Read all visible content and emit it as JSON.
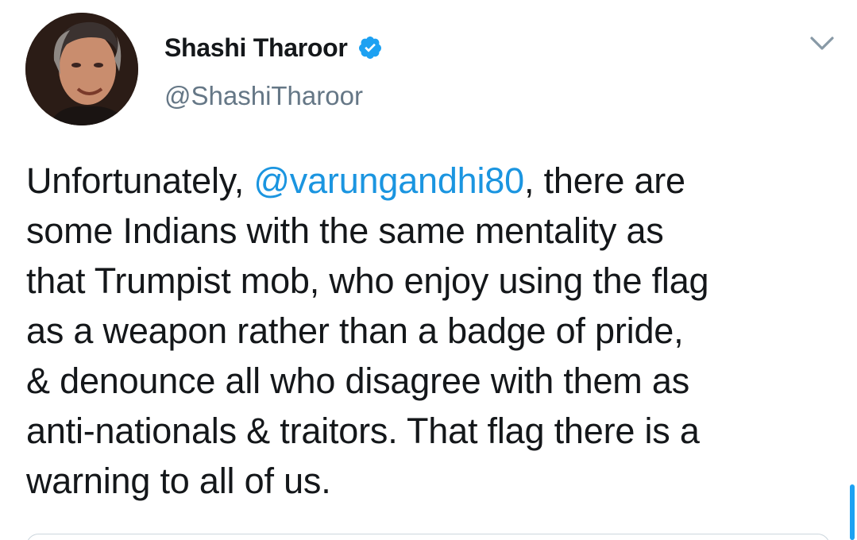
{
  "author": {
    "display_name": "Shashi Tharoor",
    "handle": "@ShashiTharoor",
    "verified": true
  },
  "icons": {
    "verified": "verified-badge-icon",
    "menu": "chevron-down-icon"
  },
  "colors": {
    "text": "#14171a",
    "secondary": "#657786",
    "mention": "#1b95e0",
    "verified": "#1da1f2"
  },
  "tweet": {
    "lines": [
      {
        "pre": "Unfortunately, ",
        "mention": "@varungandhi80",
        "post": ", there are"
      },
      {
        "text": "some Indians with the same mentality as"
      },
      {
        "text": "that Trumpist mob, who enjoy using the flag"
      },
      {
        "text": "as a weapon rather than a badge of pride,"
      },
      {
        "text": "& denounce all who disagree with them as"
      },
      {
        "text": "anti-nationals & traitors. That flag there is a"
      },
      {
        "text": "warning to all of us."
      }
    ]
  }
}
